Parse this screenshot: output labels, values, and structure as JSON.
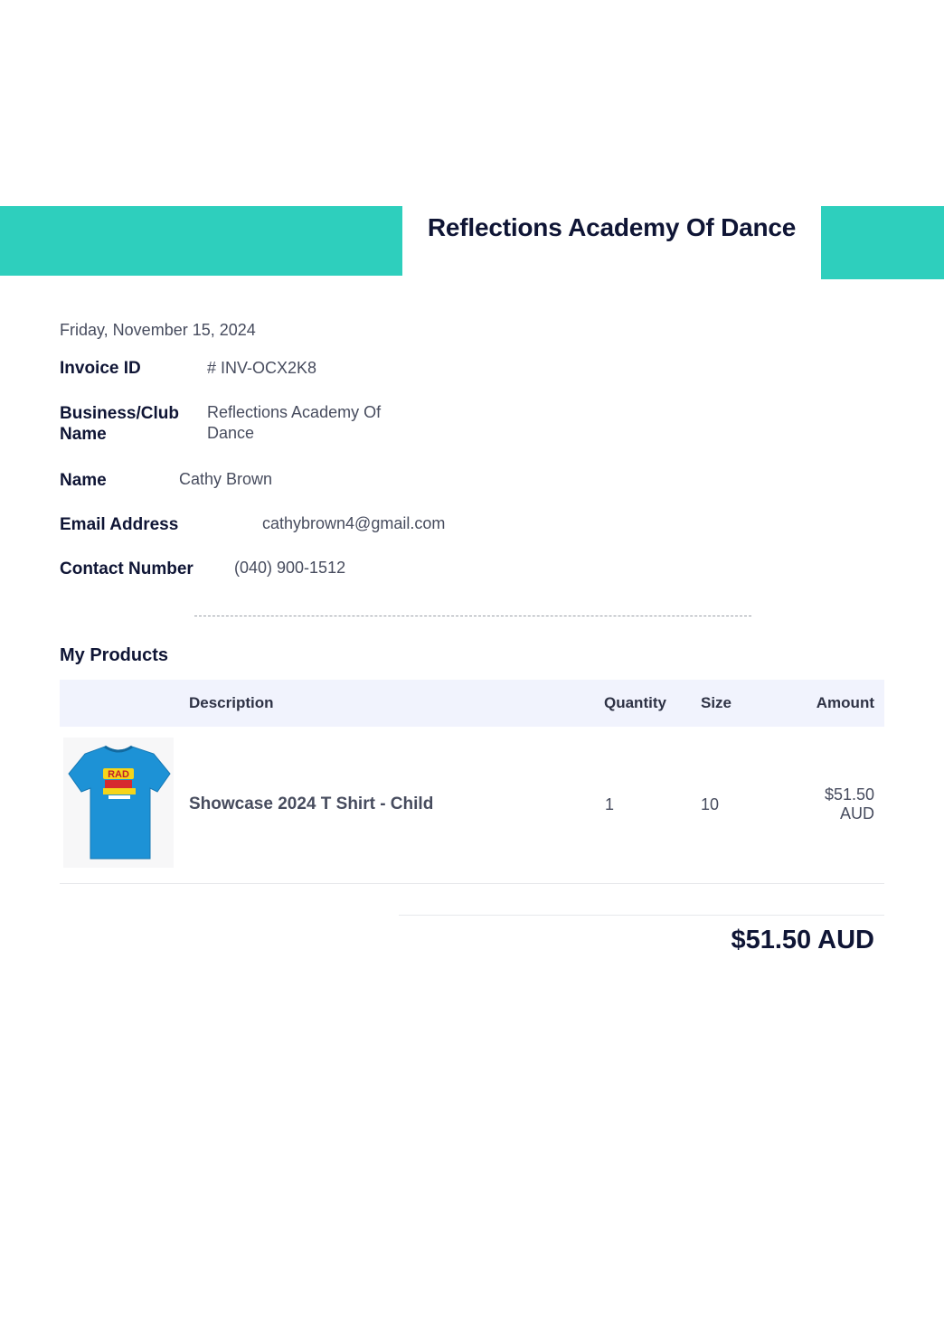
{
  "header": {
    "business_title": "Reflections Academy Of Dance",
    "accent_color": "#2ecfbd"
  },
  "invoice": {
    "date": "Friday, November 15, 2024",
    "invoice_id_label": "Invoice ID",
    "invoice_id_value": "# INV-OCX2K8",
    "business_label_line1": "Business/Club",
    "business_label_line2": "Name",
    "business_value_line1": "Reflections Academy Of",
    "business_value_line2": "Dance",
    "name_label": "Name",
    "name_value": "Cathy Brown",
    "email_label": "Email Address",
    "email_value": "cathybrown4@gmail.com",
    "contact_label": "Contact Number",
    "contact_value": "(040) 900-1512"
  },
  "products": {
    "section_title": "My Products",
    "columns": {
      "description": "Description",
      "quantity": "Quantity",
      "size": "Size",
      "amount": "Amount"
    },
    "items": [
      {
        "image_icon": "t-shirt-icon",
        "shirt_logo_text": "RAD",
        "description": "Showcase 2024 T Shirt - Child",
        "quantity": "1",
        "size": "10",
        "amount_line1": "$51.50",
        "amount_line2": "AUD"
      }
    ],
    "total": "$51.50 AUD"
  }
}
